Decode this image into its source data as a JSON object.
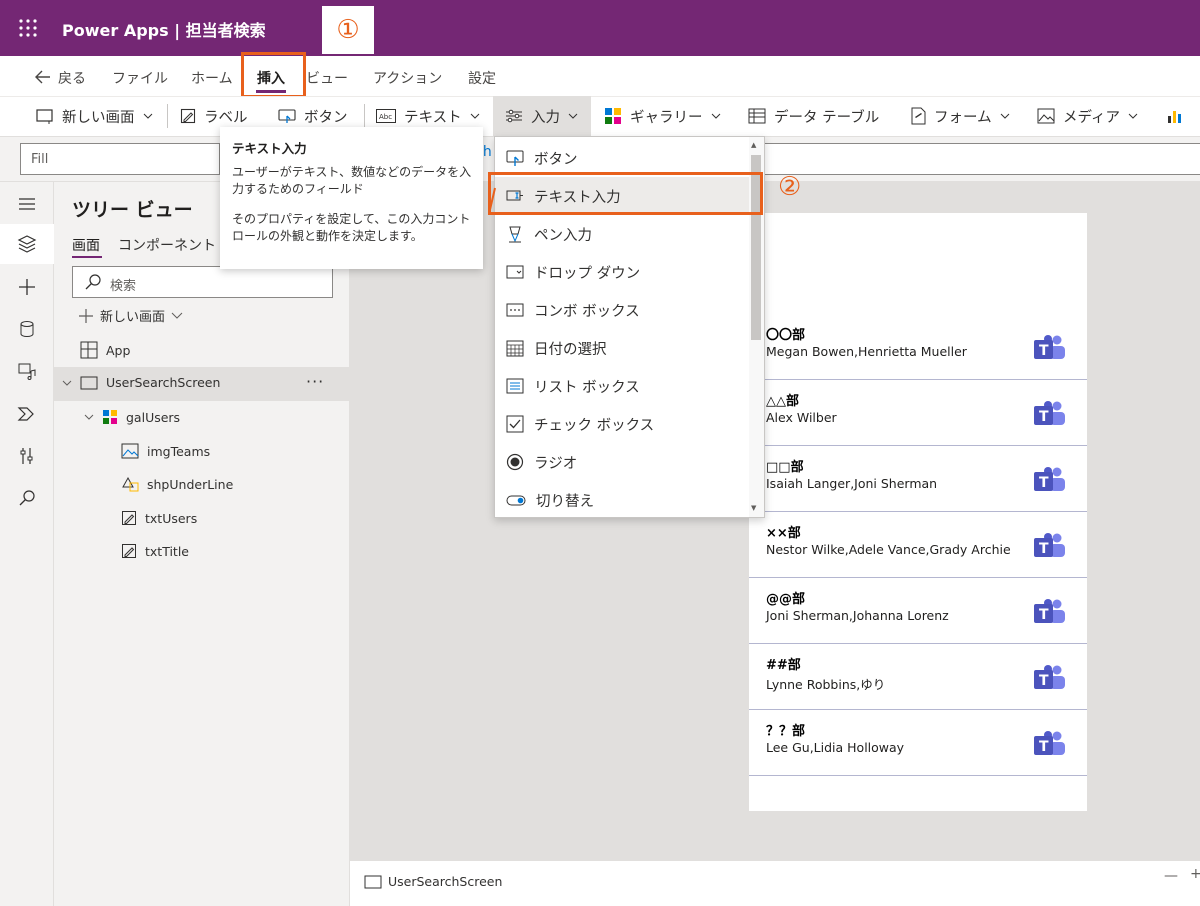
{
  "titlebar": {
    "app_title": "Power Apps | 担当者検索",
    "callout_1": "①",
    "color": "#742774"
  },
  "menu": {
    "back": "戻る",
    "file": "ファイル",
    "home": "ホーム",
    "insert": "挿入",
    "view": "ビュー",
    "action": "アクション",
    "settings": "設定"
  },
  "ribbon": {
    "new_screen": "新しい画面",
    "label": "ラベル",
    "button": "ボタン",
    "text": "テキスト",
    "input": "入力",
    "gallery": "ギャラリー",
    "data_table": "データ テーブル",
    "form": "フォーム",
    "media": "メディア"
  },
  "formula": {
    "property": "Fill",
    "partial": "lh"
  },
  "tooltip": {
    "title": "テキスト入力",
    "body1": "ユーザーがテキスト、数値などのデータを入力するためのフィールド",
    "body2": "そのプロパティを設定して、この入力コントロールの外観と動作を決定します。"
  },
  "dropdown": {
    "callout_2": "②",
    "items": [
      {
        "label": "ボタン",
        "icon": "button-icon"
      },
      {
        "label": "テキスト入力",
        "icon": "text-input-icon"
      },
      {
        "label": "ペン入力",
        "icon": "pen-icon"
      },
      {
        "label": "ドロップ ダウン",
        "icon": "dropdown-icon"
      },
      {
        "label": "コンボ ボックス",
        "icon": "combobox-icon"
      },
      {
        "label": "日付の選択",
        "icon": "calendar-icon"
      },
      {
        "label": "リスト ボックス",
        "icon": "listbox-icon"
      },
      {
        "label": "チェック ボックス",
        "icon": "checkbox-icon"
      },
      {
        "label": "ラジオ",
        "icon": "radio-icon"
      },
      {
        "label": "切り替え",
        "icon": "toggle-icon"
      }
    ]
  },
  "tree": {
    "title": "ツリー ビュー",
    "tab_screens": "画面",
    "tab_components": "コンポーネント",
    "search_placeholder": "検索",
    "new_screen": "新しい画面",
    "items": {
      "app": "App",
      "screen": "UserSearchScreen",
      "gallery": "galUsers",
      "img": "imgTeams",
      "shape": "shpUnderLine",
      "txt_users": "txtUsers",
      "txt_title": "txtTitle"
    },
    "more": "···"
  },
  "gallery": {
    "rows": [
      {
        "dept": "〇〇部",
        "users": "Megan Bowen,Henrietta Mueller"
      },
      {
        "dept": "△△部",
        "users": "Alex Wilber"
      },
      {
        "dept": "□□部",
        "users": "Isaiah Langer,Joni Sherman"
      },
      {
        "dept": "××部",
        "users": "Nestor Wilke,Adele Vance,Grady Archie"
      },
      {
        "dept": "@@部",
        "users": "Joni Sherman,Johanna Lorenz"
      },
      {
        "dept": "##部",
        "users": "Lynne Robbins,ゆり"
      },
      {
        "dept": "？？部",
        "users": "Lee Gu,Lidia Holloway"
      }
    ]
  },
  "status": {
    "screen": "UserSearchScreen",
    "minus": "—",
    "plus": "+"
  },
  "colors": {
    "accent": "#742774",
    "highlight": "#e8601c",
    "teams": "#5059c9"
  }
}
